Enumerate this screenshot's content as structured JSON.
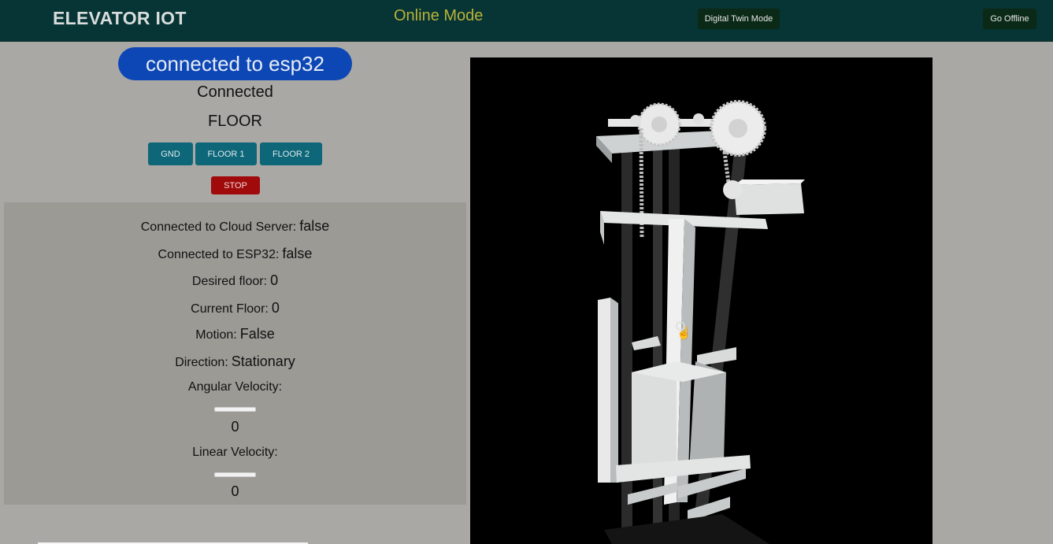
{
  "header": {
    "brand": "ELEVATOR IOT",
    "mode": "Online Mode",
    "digital_twin_button": "Digital Twin Mode",
    "go_offline_button": "Go Offline"
  },
  "connection": {
    "pill": "connected to esp32",
    "status": "Connected"
  },
  "floor_controls": {
    "title": "FLOOR",
    "buttons": [
      "GND",
      "FLOOR 1",
      "FLOOR 2"
    ],
    "stop": "STOP"
  },
  "status_panel": {
    "cloud_label": "Connected to Cloud Server:",
    "cloud_value": "false",
    "esp_label": "Connected to ESP32:",
    "esp_value": "false",
    "desired_label": "Desired floor:",
    "desired_value": "0",
    "current_label": "Current Floor:",
    "current_value": "0",
    "motion_label": "Motion:",
    "motion_value": "False",
    "direction_label": "Direction:",
    "direction_value": "Stationary",
    "angular_label": "Angular Velocity:",
    "angular_value": "0",
    "linear_label": "Linear Velocity:",
    "linear_value": "0"
  },
  "viewer": {
    "cursor_icon": "hand-pointer-icon"
  },
  "colors": {
    "header_bg": "#073434",
    "accent_blue": "#0d47b6",
    "floor_button": "#0d6779",
    "stop_button": "#a00a0a",
    "mode_text": "#b9b239"
  }
}
